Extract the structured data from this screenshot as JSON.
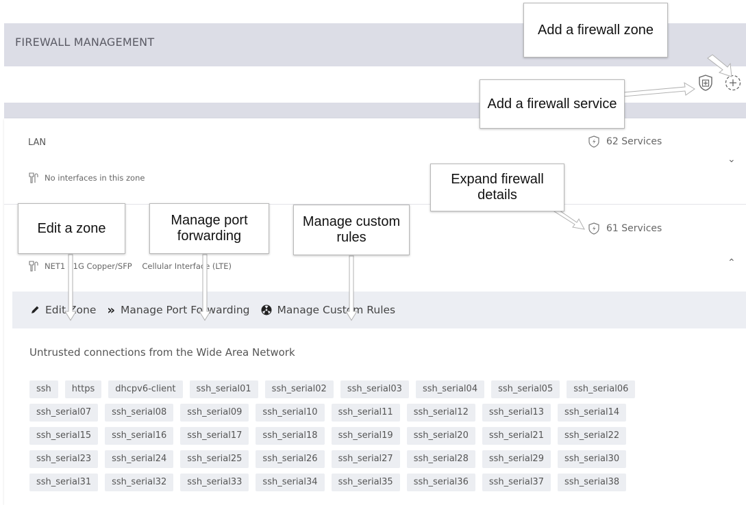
{
  "page": {
    "title": "FIREWALL MANAGEMENT"
  },
  "toolbar": {
    "add_service_icon": "shield-plus-icon",
    "add_zone_icon": "plus-circle-icon"
  },
  "zones": [
    {
      "name": "LAN",
      "interfaces": "No interfaces in this zone",
      "services": "62 Services",
      "expanded": false
    },
    {
      "name": "",
      "interfaces": "NET1 - 1G Copper/SFP    Cellular Interface (LTE)",
      "services": "61 Services",
      "expanded": true
    }
  ],
  "actions": {
    "edit_zone": "Edit Zone",
    "port_forwarding": "Manage Port Forwarding",
    "custom_rules": "Manage Custom Rules"
  },
  "zone_description": "Untrusted connections from the Wide Area Network",
  "service_tags": [
    "ssh",
    "https",
    "dhcpv6-client",
    "ssh_serial01",
    "ssh_serial02",
    "ssh_serial03",
    "ssh_serial04",
    "ssh_serial05",
    "ssh_serial06",
    "ssh_serial07",
    "ssh_serial08",
    "ssh_serial09",
    "ssh_serial10",
    "ssh_serial11",
    "ssh_serial12",
    "ssh_serial13",
    "ssh_serial14",
    "ssh_serial15",
    "ssh_serial16",
    "ssh_serial17",
    "ssh_serial18",
    "ssh_serial19",
    "ssh_serial20",
    "ssh_serial21",
    "ssh_serial22",
    "ssh_serial23",
    "ssh_serial24",
    "ssh_serial25",
    "ssh_serial26",
    "ssh_serial27",
    "ssh_serial28",
    "ssh_serial29",
    "ssh_serial30",
    "ssh_serial31",
    "ssh_serial32",
    "ssh_serial33",
    "ssh_serial34",
    "ssh_serial35",
    "ssh_serial36",
    "ssh_serial37",
    "ssh_serial38"
  ],
  "callouts": {
    "add_zone": "Add a firewall zone",
    "add_service": "Add a firewall service",
    "expand": "Expand firewall details",
    "edit_zone": "Edit a zone",
    "port_forwarding": "Manage port forwarding",
    "custom_rules": "Manage custom rules"
  }
}
